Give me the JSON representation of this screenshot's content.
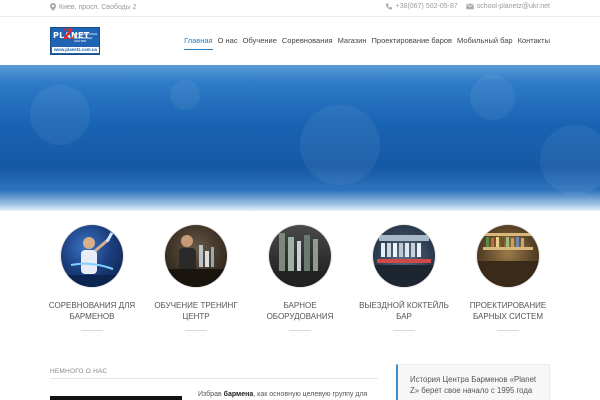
{
  "topbar": {
    "address": "Киев, просп. Свободы 2",
    "phone": "+38(067) 502-05-87",
    "email": "school-planetz@ukr.net"
  },
  "logo": {
    "name": "PLANET",
    "letter": "Z",
    "subtitle": "INTERNATIONAL BARTENDER CENTER",
    "url": "www.planetz.com.ua"
  },
  "nav": {
    "items": [
      {
        "label": "Главная",
        "active": true
      },
      {
        "label": "О нас"
      },
      {
        "label": "Обучение"
      },
      {
        "label": "Соревнования"
      },
      {
        "label": "Магазин"
      },
      {
        "label": "Проектирование баров"
      },
      {
        "label": "Мобильный бар"
      },
      {
        "label": "Контакты"
      }
    ]
  },
  "services": [
    {
      "line1": "Соревнования для",
      "line2": "барменов"
    },
    {
      "line1": "Обучение тренинг",
      "line2": "центр"
    },
    {
      "line1": "Барное",
      "line2": "оборудования"
    },
    {
      "line1": "Выездной коктейль",
      "line2": "бар"
    },
    {
      "line1": "Проектирование",
      "line2": "барных систем"
    }
  ],
  "about": {
    "label": "Немного о нас",
    "intro_prefix": "Избрав ",
    "intro_bold": "бармена",
    "intro_suffix": ", как основную целевую группу для"
  },
  "aside": {
    "line1": "История Центра Барменов «Planet",
    "line2": "Z» берет свое начало с 1995 года"
  },
  "colors": {
    "accent": "#2a7fc3",
    "hero": "#1964b3",
    "logo_bg": "#1f63b3"
  }
}
